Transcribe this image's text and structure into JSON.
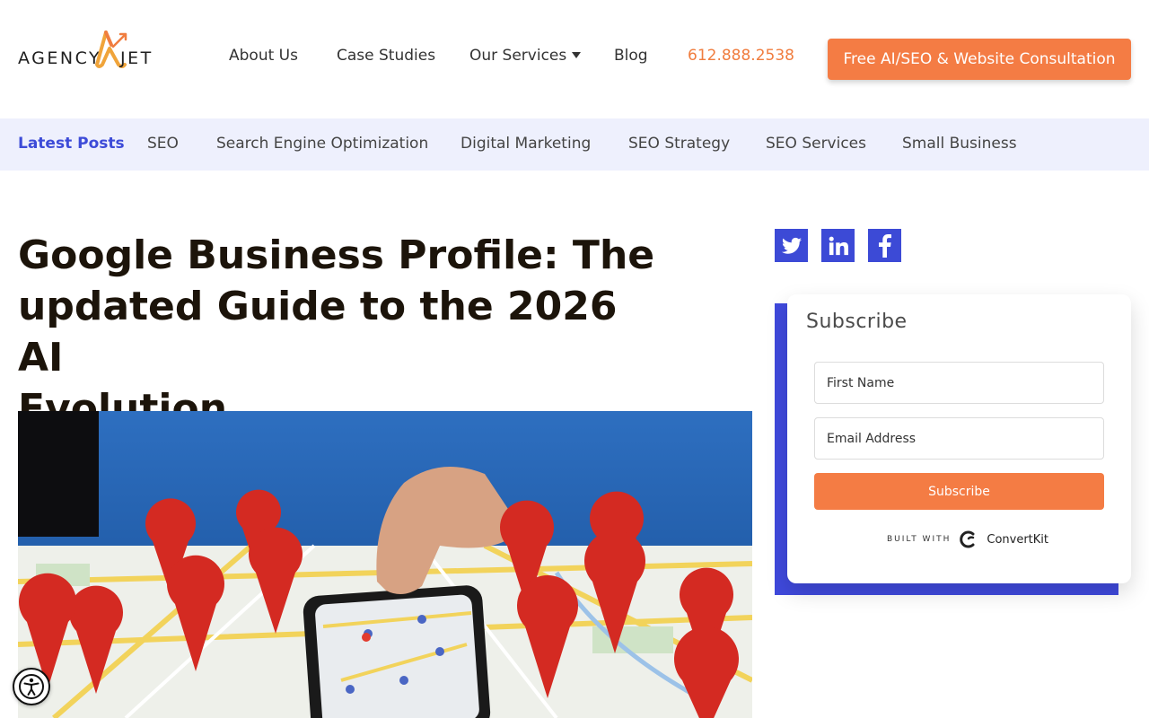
{
  "header": {
    "logo": {
      "left": "AGENCY",
      "right": "JET"
    },
    "nav": {
      "about": "About Us",
      "case_studies": "Case Studies",
      "services": "Our Services",
      "blog": "Blog",
      "phone": "612.888.2538"
    },
    "cta": "Free AI/SEO & Website Consultation"
  },
  "categories": {
    "latest": "Latest Posts",
    "items": [
      "SEO",
      "Search Engine Optimization",
      "Digital Marketing",
      "SEO Strategy",
      "SEO Services",
      "Small Business"
    ]
  },
  "article": {
    "title_lines": [
      "Google Business Profile: The",
      "updated Guide to the 2026 AI",
      "Evolution"
    ]
  },
  "social": [
    "twitter-icon",
    "linkedin-icon",
    "facebook-icon"
  ],
  "subscribe": {
    "title": "Subscribe",
    "first_name_placeholder": "First Name",
    "email_placeholder": "Email Address",
    "button": "Subscribe",
    "built_with": "BUILT WITH",
    "provider": "ConvertKit"
  },
  "colors": {
    "accent_orange": "#f47c44",
    "brand_blue": "#3c4ad6",
    "category_bg": "#eef0fd"
  }
}
